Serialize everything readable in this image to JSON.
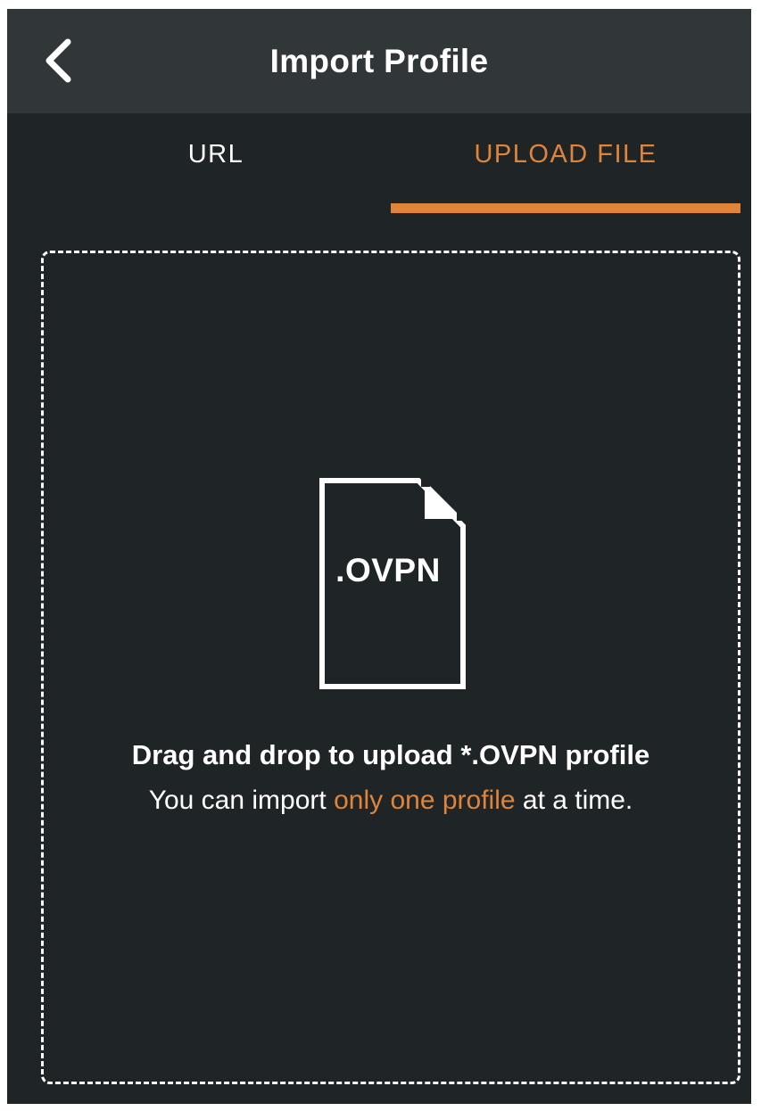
{
  "header": {
    "title": "Import Profile",
    "back_icon": "chevron-left-icon"
  },
  "tabs": [
    {
      "label": "URL",
      "active": false
    },
    {
      "label": "UPLOAD FILE",
      "active": true
    }
  ],
  "dropzone": {
    "file_icon": "file-icon",
    "file_extension": ".OVPN",
    "title": "Drag and drop to upload *.OVPN profile",
    "note_prefix": "You can import ",
    "note_highlight": "only one profile",
    "note_suffix": " at a time."
  },
  "colors": {
    "background": "#1f2426",
    "header": "#313638",
    "accent": "#e0843a",
    "text": "#ffffff"
  }
}
